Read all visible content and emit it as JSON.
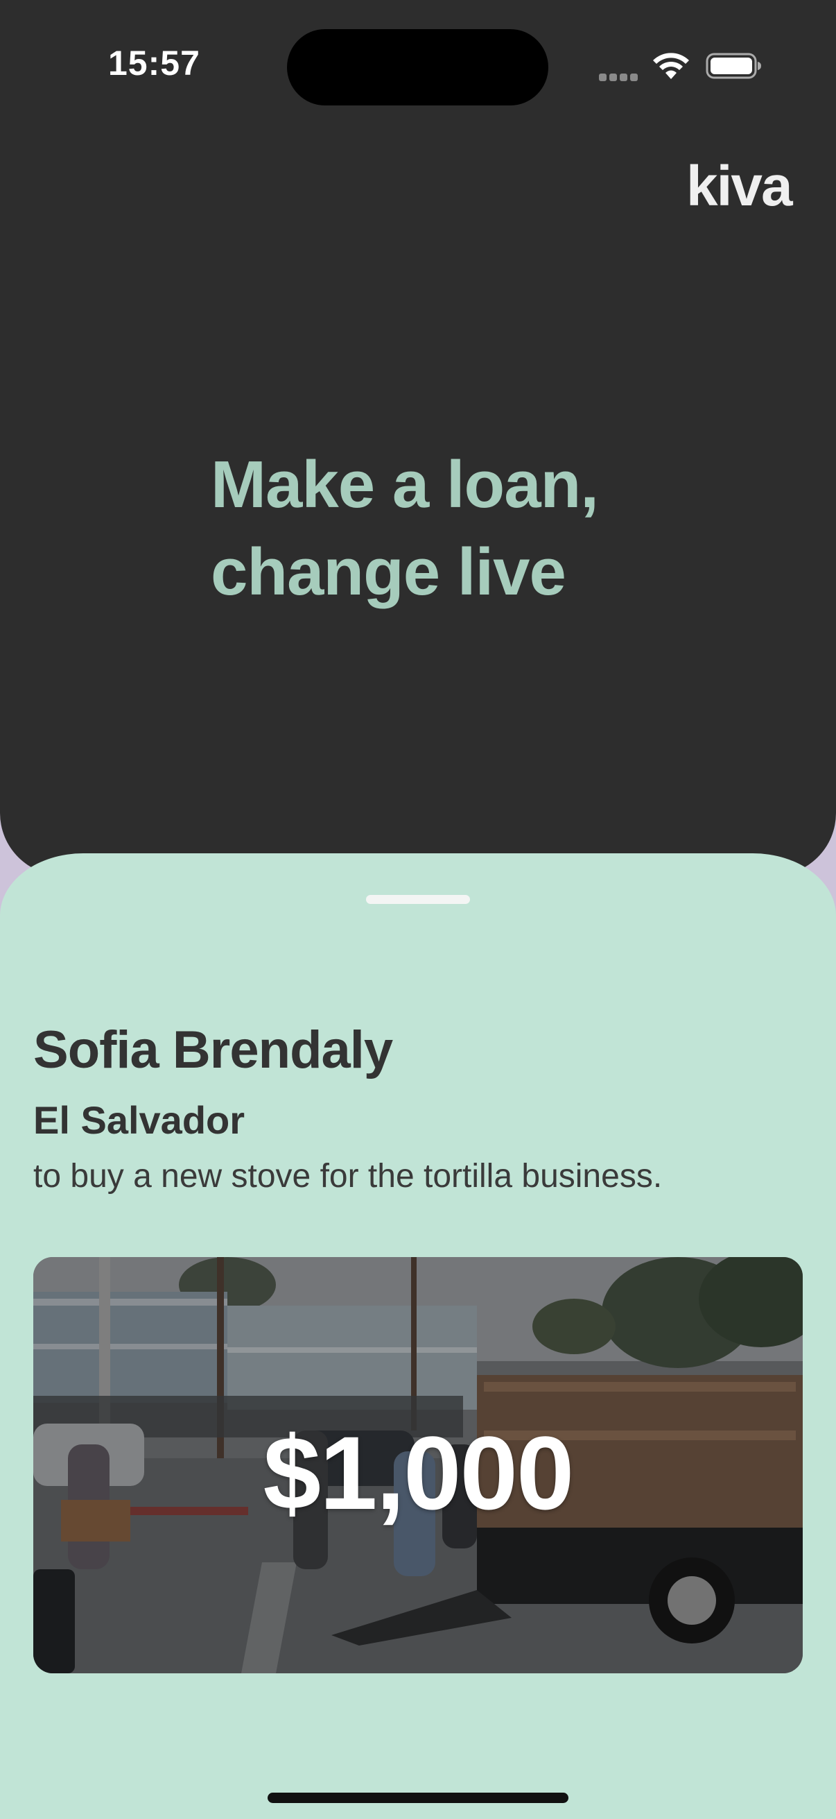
{
  "status_bar": {
    "time": "15:57",
    "wifi_icon": "wifi-icon",
    "battery_icon": "battery-icon"
  },
  "brand": {
    "logo_text": "kiva"
  },
  "hero": {
    "headline_line1": "Make a loan,",
    "headline_line2": "change live",
    "background_color": "#2d2d2d",
    "headline_color": "#a6ccbc"
  },
  "loan": {
    "borrower_name": "Sofia Brendaly",
    "country": "El Salvador",
    "purpose": "to buy a new stove for the tortilla business.",
    "amount": "$1,000",
    "card_background_color": "#c1e4d6"
  }
}
